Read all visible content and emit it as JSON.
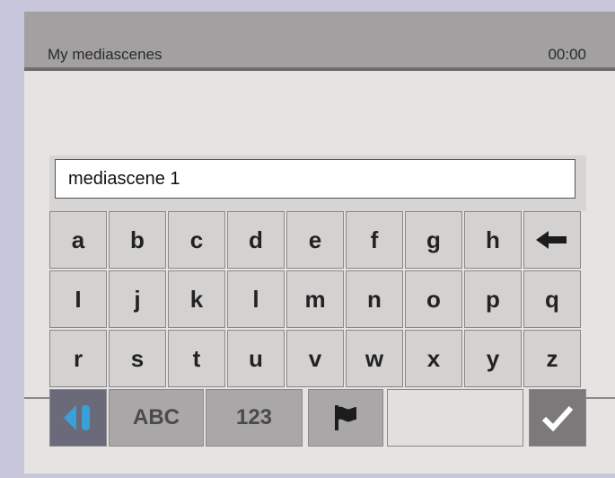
{
  "header": {
    "title": "My mediascenes",
    "clock": "00:00"
  },
  "input": {
    "value": "mediascene 1"
  },
  "keyboard": {
    "row1": [
      "a",
      "b",
      "c",
      "d",
      "e",
      "f",
      "g",
      "h"
    ],
    "row2": [
      "I",
      "j",
      "k",
      "l",
      "m",
      "n",
      "o",
      "p",
      "q"
    ],
    "row3": [
      "r",
      "s",
      "t",
      "u",
      "v",
      "w",
      "x",
      "y",
      "z"
    ],
    "bottom": {
      "abc": "ABC",
      "num": "123"
    }
  },
  "icons": {
    "backspace": "arrow-left-icon",
    "nav": "nav-left-icon",
    "flag": "flag-icon",
    "ok": "checkmark-icon"
  },
  "colors": {
    "background": "#c7c6db",
    "header": "#a2a0a1",
    "nav_key": "#6a6a7a",
    "ok_key": "#7b7979"
  }
}
